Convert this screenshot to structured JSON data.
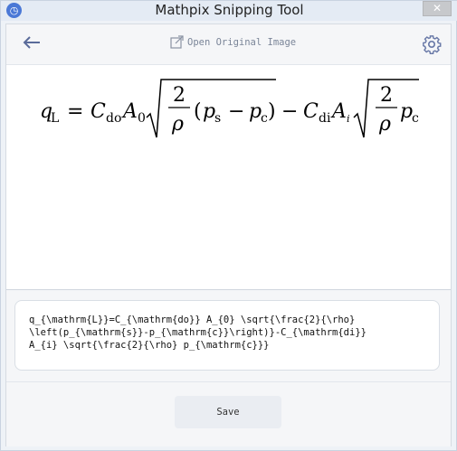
{
  "window": {
    "title": "Mathpix Snipping Tool",
    "app_icon": "mathpix-logo-icon",
    "close_glyph": "✕"
  },
  "toolbar": {
    "back_glyph": "←",
    "open_original_label": "Open Original Image",
    "open_icon": "external-link-icon",
    "settings_icon": "gear-icon"
  },
  "preview": {
    "formula_latex": "q_{\\mathrm{L}}=C_{\\mathrm{do}} A_{0} \\sqrt{\\frac{2}{\\rho}\\left(p_{\\mathrm{s}}-p_{\\mathrm{c}}\\right)}-C_{\\mathrm{di}} A_{i} \\sqrt{\\frac{2}{\\rho} p_{\\mathrm{c}}}"
  },
  "latex_output": {
    "text": "q_{\\mathrm{L}}=C_{\\mathrm{do}} A_{0} \\sqrt{\\frac{2}{\\rho}\n\\left(p_{\\mathrm{s}}-p_{\\mathrm{c}}\\right)}-C_{\\mathrm{di}}\nA_{i} \\sqrt{\\frac{2}{\\rho} p_{\\mathrm{c}}}"
  },
  "footer": {
    "save_label": "Save"
  },
  "colors": {
    "accent": "#4a78d6",
    "icon": "#5a6b9a"
  }
}
